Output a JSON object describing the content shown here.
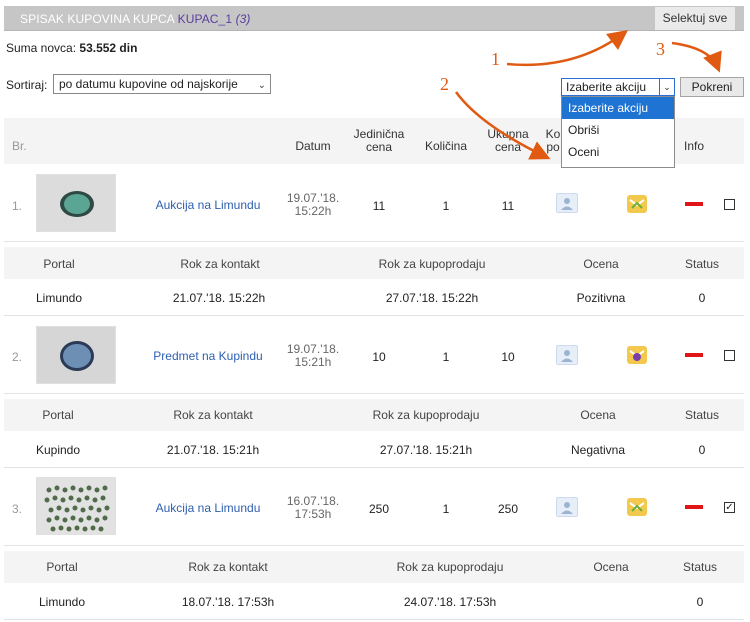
{
  "header": {
    "title": "SPISAK KUPOVINA KUPCA",
    "buyer": "KUPAC_1",
    "count": "(3)",
    "select_all": "Selektuj sve"
  },
  "sum": {
    "label": "Suma novca:",
    "value": "53.552 din"
  },
  "sort": {
    "label": "Sortiraj:",
    "selected": "po datumu kupovine od najskorije"
  },
  "action": {
    "selected": "Izaberite akciju",
    "options": [
      "Izaberite akciju",
      "Obriši",
      "Oceni"
    ],
    "run_label": "Pokreni"
  },
  "columns": {
    "br": "Br.",
    "date": "Datum",
    "unit_price_1": "Jedinična",
    "unit_price_2": "cena",
    "quantity": "Količina",
    "total_1": "Ukupna",
    "total_2": "cena",
    "contact_1": "Ko",
    "contact_2": "po",
    "info": "Info"
  },
  "sub_columns": {
    "portal": "Portal",
    "contact_deadline": "Rok za kontakt",
    "sale_deadline": "Rok za kupoprodaju",
    "rating": "Ocena",
    "status": "Status"
  },
  "rows": [
    {
      "index": "1.",
      "title": "Aukcija na Limundu",
      "date_1": "19.07.'18.",
      "date_2": "15:22h",
      "unit_price": "11",
      "quantity": "1",
      "total": "11",
      "checked": false,
      "portal": "Limundo",
      "contact_deadline": "21.07.'18. 15:22h",
      "sale_deadline": "27.07.'18. 15:22h",
      "rating": "Pozitivna",
      "status": "0"
    },
    {
      "index": "2.",
      "title": "Predmet na Kupindu",
      "date_1": "19.07.'18.",
      "date_2": "15:21h",
      "unit_price": "10",
      "quantity": "1",
      "total": "10",
      "checked": false,
      "portal": "Kupindo",
      "contact_deadline": "21.07.'18. 15:21h",
      "sale_deadline": "27.07.'18. 15:21h",
      "rating": "Negativna",
      "status": "0"
    },
    {
      "index": "3.",
      "title": "Aukcija na Limundu",
      "date_1": "16.07.'18.",
      "date_2": "17:53h",
      "unit_price": "250",
      "quantity": "1",
      "total": "250",
      "checked": true,
      "check_mark": "✓",
      "portal": "Limundo",
      "contact_deadline": "18.07.'18. 17:53h",
      "sale_deadline": "24.07.'18. 17:53h",
      "rating": "",
      "status": "0"
    }
  ],
  "annotations": [
    "1",
    "2",
    "3"
  ],
  "colors": {
    "accent": "#e05a12",
    "link": "#2e5fb0",
    "header_bg": "#c6c6c6",
    "remove": "#e01515",
    "selected_option": "#1e73d3"
  }
}
